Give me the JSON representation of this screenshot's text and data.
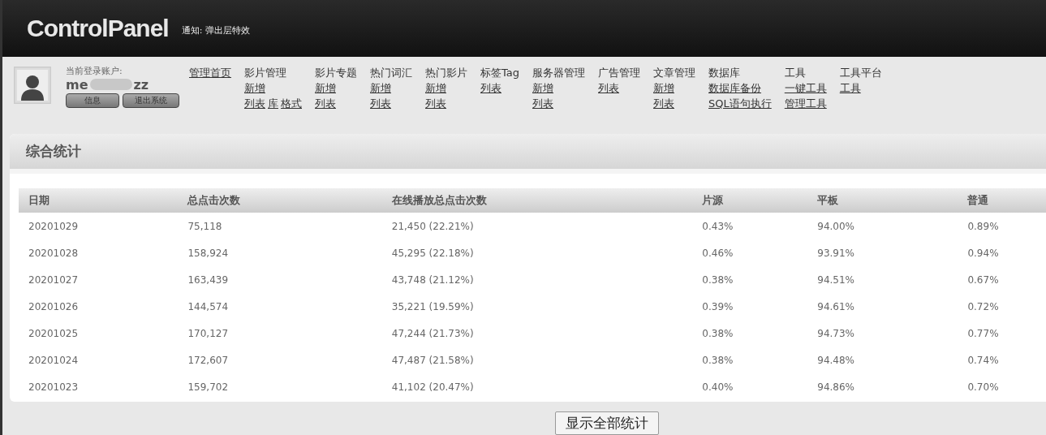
{
  "header": {
    "logo": "ControlPanel",
    "notice": "通知: 弹出层特效"
  },
  "account": {
    "label": "当前登录账户:",
    "name_parts": [
      "me",
      "zz"
    ],
    "name_redacted": true,
    "buttons": [
      "信息",
      "退出系统"
    ]
  },
  "nav": [
    {
      "title": "管理首页",
      "title_link": true
    },
    {
      "title": "影片管理",
      "title_link": false,
      "lines": [
        [
          "新增"
        ],
        [
          "列表",
          "库",
          "格式"
        ]
      ]
    },
    {
      "title": "影片专题",
      "title_link": false,
      "lines": [
        [
          "新增"
        ],
        [
          "列表"
        ]
      ]
    },
    {
      "title": "热门词汇",
      "title_link": false,
      "lines": [
        [
          "新增"
        ],
        [
          "列表"
        ]
      ]
    },
    {
      "title": "热门影片",
      "title_link": false,
      "lines": [
        [
          "新增"
        ],
        [
          "列表"
        ]
      ]
    },
    {
      "title": "标签Tag",
      "title_link": false,
      "lines": [
        [
          "列表"
        ]
      ]
    },
    {
      "title": "服务器管理",
      "title_link": false,
      "lines": [
        [
          "新增"
        ],
        [
          "列表"
        ]
      ]
    },
    {
      "title": "广告管理",
      "title_link": false,
      "lines": [
        [
          "列表"
        ]
      ]
    },
    {
      "title": "文章管理",
      "title_link": false,
      "lines": [
        [
          "新增"
        ],
        [
          "列表"
        ]
      ]
    },
    {
      "title": "数据库",
      "title_link": false,
      "lines": [
        [
          "数据库备份"
        ],
        [
          "SQL语句执行"
        ]
      ]
    },
    {
      "title": "工具",
      "title_link": false,
      "lines": [
        [
          "一键工具"
        ],
        [
          "管理工具"
        ]
      ]
    },
    {
      "title": "工具平台",
      "title_link": false,
      "lines": [
        [
          "工具"
        ]
      ]
    }
  ],
  "panel": {
    "title": "综合统计",
    "table": {
      "columns": [
        "日期",
        "总点击次数",
        "在线播放总点击次数",
        "片源",
        "平板",
        "普通"
      ],
      "rows": [
        [
          "20201029",
          "75,118",
          "21,450 (22.21%)",
          "0.43%",
          "94.00%",
          "0.89%"
        ],
        [
          "20201028",
          "158,924",
          "45,295 (22.18%)",
          "0.46%",
          "93.91%",
          "0.94%"
        ],
        [
          "20201027",
          "163,439",
          "43,748 (21.12%)",
          "0.38%",
          "94.51%",
          "0.67%"
        ],
        [
          "20201026",
          "144,574",
          "35,221 (19.59%)",
          "0.39%",
          "94.61%",
          "0.72%"
        ],
        [
          "20201025",
          "170,127",
          "47,244 (21.73%)",
          "0.38%",
          "94.73%",
          "0.77%"
        ],
        [
          "20201024",
          "172,607",
          "47,487 (21.58%)",
          "0.38%",
          "94.48%",
          "0.74%"
        ],
        [
          "20201023",
          "159,702",
          "41,102 (20.47%)",
          "0.40%",
          "94.86%",
          "0.70%"
        ]
      ]
    }
  },
  "show_all_button": "显示全部统计"
}
